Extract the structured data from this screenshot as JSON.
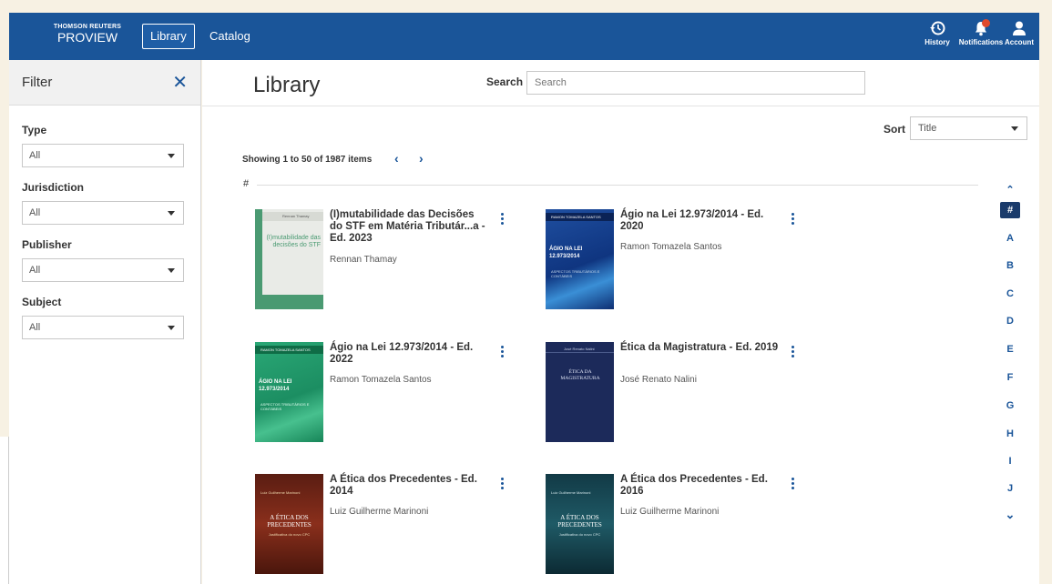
{
  "header": {
    "logo_small": "THOMSON REUTERS",
    "logo_big": "PROVIEW",
    "nav_library": "Library",
    "nav_catalog": "Catalog",
    "history_label": "History",
    "notifications_label": "Notifications",
    "account_label": "Account",
    "brand_color": "#1a5599"
  },
  "filter": {
    "title": "Filter",
    "groups": [
      {
        "label": "Type",
        "value": "All"
      },
      {
        "label": "Jurisdiction",
        "value": "All"
      },
      {
        "label": "Publisher",
        "value": "All"
      },
      {
        "label": "Subject",
        "value": "All"
      }
    ]
  },
  "main": {
    "title": "Library",
    "search_label": "Search",
    "search_placeholder": "Search",
    "sort_label": "Sort",
    "sort_value": "Title",
    "showing": "Showing 1 to 50 of 1987 items",
    "section": "#",
    "books": [
      {
        "title": "(I)mutabilidade das Decisões do STF em Matéria Tributár...a - Ed. 2023",
        "author": "Rennan Thamay"
      },
      {
        "title": "Ágio na Lei 12.973/2014 - Ed. 2020",
        "author": "Ramon Tomazela Santos"
      },
      {
        "title": "Ágio na Lei 12.973/2014 - Ed. 2022",
        "author": "Ramon Tomazela Santos"
      },
      {
        "title": "Ética da Magistratura - Ed. 2019",
        "author": "José Renato Nalini"
      },
      {
        "title": "A Ética dos Precedentes - Ed. 2014",
        "author": "Luiz Guilherme Marinoni"
      },
      {
        "title": "A Ética dos Precedentes - Ed. 2016",
        "author": "Luiz Guilherme Marinoni"
      }
    ],
    "covers": [
      {
        "top": "Rennan Thamay",
        "main": "(I)mutabilidade das decisões do STF"
      },
      {
        "top": "RAMON TOMAZELA SANTOS",
        "main": "ÁGIO NA LEI 12.973/2014",
        "sub": "ASPECTOS TRIBUTÁRIOS E CONTÁBEIS"
      },
      {
        "top": "RAMON TOMAZELA SANTOS",
        "main": "ÁGIO NA LEI 12.973/2014",
        "sub": "ASPECTOS TRIBUTÁRIOS E CONTÁBEIS"
      },
      {
        "top": "José Renato Nalini",
        "main": "ÉTICA DA MAGISTRATURA"
      },
      {
        "top": "Luiz Guilherme Marinoni",
        "main": "A ÉTICA DOS PRECEDENTES",
        "sub": "Justificativa do novo CPC"
      },
      {
        "top": "Luiz Guilherme Marinoni",
        "main": "A ÉTICA DOS PRECEDENTES",
        "sub": "Justificativa do novo CPC"
      }
    ],
    "alphabet": [
      "#",
      "A",
      "B",
      "C",
      "D",
      "E",
      "F",
      "G",
      "H",
      "I",
      "J"
    ],
    "alphabet_active": "#"
  }
}
